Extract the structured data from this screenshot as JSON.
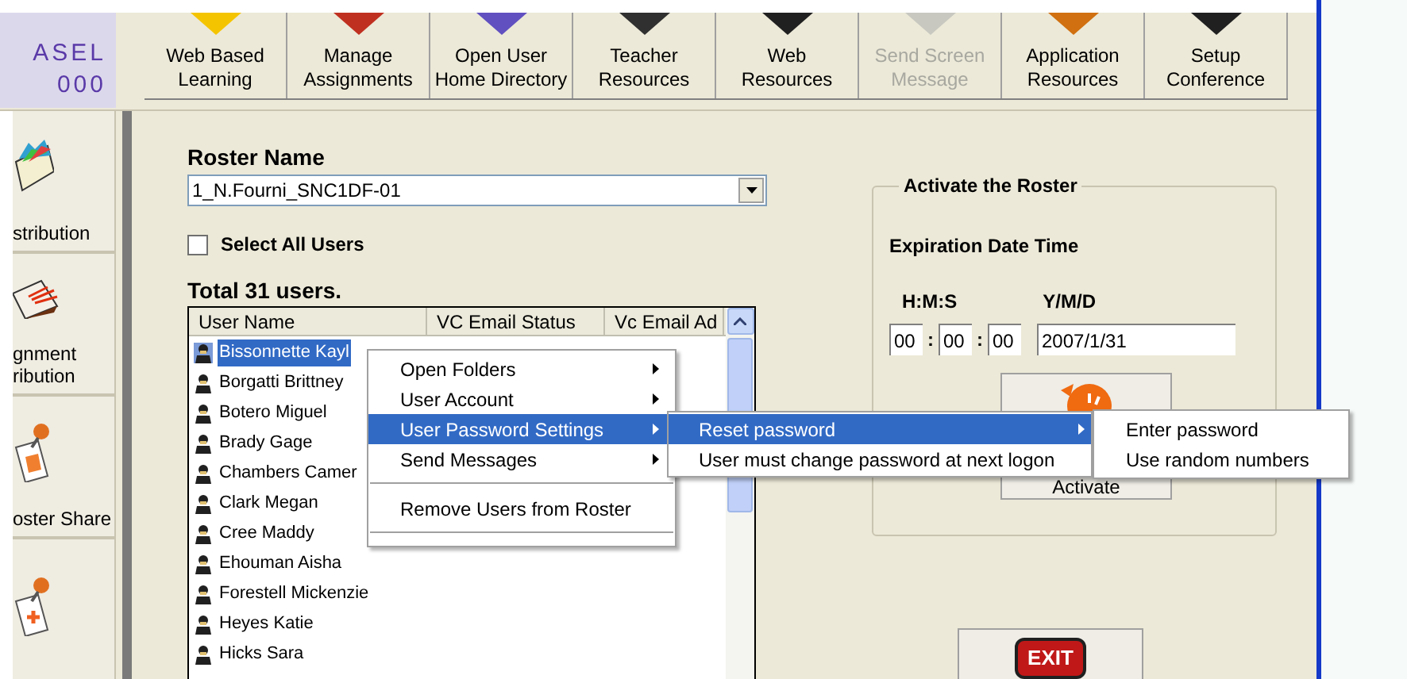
{
  "logo": {
    "lines": [
      "ASEL",
      "000"
    ]
  },
  "toolbar": [
    {
      "lines": [
        "Web Based",
        "Learning"
      ],
      "disabled": false
    },
    {
      "lines": [
        "Manage",
        "Assignments"
      ],
      "disabled": false
    },
    {
      "lines": [
        "Open User",
        "Home Directory"
      ],
      "disabled": false
    },
    {
      "lines": [
        "Teacher",
        "Resources"
      ],
      "disabled": false
    },
    {
      "lines": [
        "Web",
        "Resources"
      ],
      "disabled": false
    },
    {
      "lines": [
        "Send Screen",
        "Message"
      ],
      "disabled": true
    },
    {
      "lines": [
        "Application",
        "Resources"
      ],
      "disabled": false
    },
    {
      "lines": [
        "Setup",
        "Conference"
      ],
      "disabled": false
    }
  ],
  "sidebar": {
    "items": [
      {
        "kind": "labeled",
        "lines": [
          "stribution"
        ]
      },
      {
        "kind": "labeled",
        "lines": [
          "gnment",
          "ribution"
        ]
      },
      {
        "kind": "labeled",
        "lines": [
          "oster Share"
        ]
      },
      {
        "kind": "icon"
      }
    ]
  },
  "roster": {
    "label": "Roster Name",
    "value": "1_N.Fourni_SNC1DF-01"
  },
  "select_all": {
    "label": "Select All Users",
    "checked": false
  },
  "total": "Total 31 users.",
  "table": {
    "columns": [
      "User Name",
      "VC Email Status",
      "Vc Email Ad"
    ],
    "rows": [
      {
        "name": "Bissonnette Kayl",
        "selected": true
      },
      {
        "name": "Borgatti Brittney",
        "selected": false
      },
      {
        "name": "Botero Miguel",
        "selected": false
      },
      {
        "name": "Brady Gage",
        "selected": false
      },
      {
        "name": "Chambers Camer",
        "selected": false
      },
      {
        "name": "Clark Megan",
        "selected": false
      },
      {
        "name": "Cree Maddy",
        "selected": false
      },
      {
        "name": "Ehouman Aisha",
        "selected": false
      },
      {
        "name": "Forestell Mickenzie",
        "selected": false
      },
      {
        "name": "Heyes Katie",
        "selected": false
      },
      {
        "name": "Hicks Sara",
        "selected": false
      }
    ]
  },
  "context_menu": {
    "items": [
      {
        "kind": "item",
        "label": "Open Folders",
        "submenu": true,
        "selected": false
      },
      {
        "kind": "item",
        "label": "User Account",
        "submenu": true,
        "selected": false
      },
      {
        "kind": "item",
        "label": "User Password Settings",
        "submenu": true,
        "selected": true
      },
      {
        "kind": "item",
        "label": "Send Messages",
        "submenu": true,
        "selected": false
      },
      {
        "kind": "separator"
      },
      {
        "kind": "item",
        "label": "Remove Users from Roster",
        "submenu": false,
        "selected": false
      },
      {
        "kind": "separator"
      }
    ]
  },
  "submenu": {
    "items": [
      {
        "label": "Reset password",
        "submenu": true,
        "selected": true
      },
      {
        "label": "User must change password at next logon",
        "submenu": false,
        "selected": false
      }
    ]
  },
  "submenu_2": {
    "items": [
      {
        "label": "Enter password",
        "selected": false
      },
      {
        "label": "Use random numbers",
        "selected": false
      }
    ]
  },
  "activate": {
    "title": "Activate the Roster",
    "subtitle": "Expiration Date Time",
    "time_label": "H:M:S",
    "time_separators": [
      ":",
      ":"
    ],
    "date_label": "Y/M/D",
    "hours": "00",
    "minutes": "00",
    "seconds": "00",
    "date": "2007/1/31",
    "button": "Activate"
  },
  "exit": {
    "label": "EXIT"
  }
}
